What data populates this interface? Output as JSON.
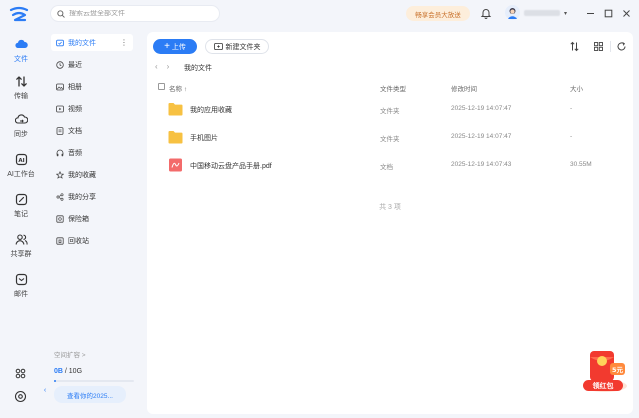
{
  "search": {
    "placeholder": "搜索云盘全部文件"
  },
  "header": {
    "promo_label": "畅享会员大放送",
    "icons": {
      "bell": "bell-icon",
      "minimize": "minimize-icon",
      "maximize": "maximize-icon",
      "close": "close-icon"
    }
  },
  "rail": {
    "items": [
      {
        "label": "文件",
        "icon": "cloud-folder-icon",
        "active": true
      },
      {
        "label": "传输",
        "icon": "transfer-arrows-icon"
      },
      {
        "label": "同步",
        "icon": "sync-icon"
      },
      {
        "label": "AI工作台",
        "icon": "ai-icon"
      },
      {
        "label": "笔记",
        "icon": "note-icon"
      },
      {
        "label": "共享群",
        "icon": "group-icon"
      },
      {
        "label": "邮件",
        "icon": "mail-icon"
      }
    ],
    "bottom_icons": [
      "apps-grid-icon",
      "settings-icon"
    ]
  },
  "nav": {
    "items": [
      {
        "label": "我的文件",
        "icon": "folder-icon",
        "active": true
      },
      {
        "label": "最近",
        "icon": "clock-icon"
      },
      {
        "label": "相册",
        "icon": "photo-icon"
      },
      {
        "label": "视频",
        "icon": "video-icon"
      },
      {
        "label": "文档",
        "icon": "document-icon"
      },
      {
        "label": "音频",
        "icon": "audio-icon"
      },
      {
        "label": "我的收藏",
        "icon": "star-icon"
      },
      {
        "label": "我的分享",
        "icon": "share-icon"
      },
      {
        "label": "保险箱",
        "icon": "safe-icon"
      },
      {
        "label": "回收站",
        "icon": "trash-icon"
      }
    ],
    "storage_label": "空间扩容 >",
    "storage_used": "0B",
    "storage_total": " / 10G",
    "storage_fraction": 0,
    "report_label": "查看你的2025..."
  },
  "toolbar": {
    "upload_label": "上传",
    "newfolder_label": "新建文件夹"
  },
  "breadcrumb": {
    "current": "我的文件"
  },
  "table": {
    "headers": {
      "name": "名称",
      "type": "文件类型",
      "modified": "修改时间",
      "size": "大小"
    },
    "rows": [
      {
        "name": "我的应用收藏",
        "type": "文件夹",
        "modified": "2025-12-19 14:07:47",
        "size": "-",
        "icon": "folder-icon"
      },
      {
        "name": "手机图片",
        "type": "文件夹",
        "modified": "2025-12-19 14:07:47",
        "size": "-",
        "icon": "folder-icon"
      },
      {
        "name": "中国移动云盘产品手册.pdf",
        "type": "文档",
        "modified": "2025-12-19 14:07:43",
        "size": "30.55M",
        "icon": "pdf-icon"
      }
    ],
    "count_label": "共 3 项"
  },
  "gift": {
    "label": "领红包",
    "badge": "5元"
  },
  "colors": {
    "accent": "#2b7cf5",
    "folder": "#f7c142",
    "pdf": "#f36b6b"
  }
}
